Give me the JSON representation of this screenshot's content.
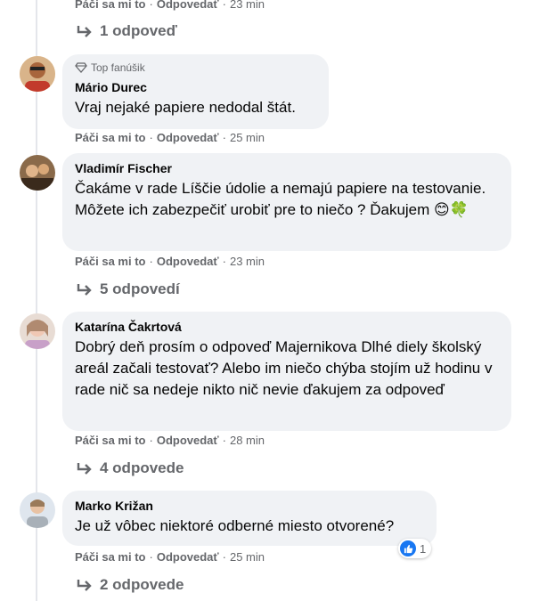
{
  "comments": [
    {
      "actions": {
        "like": "Páči sa mi to",
        "reply": "Odpovedať",
        "time": "23 min"
      },
      "replies_label": "1 odpoveď"
    },
    {
      "badge": "Top fanúšik",
      "author": "Mário Durec",
      "text": "Vraj nejaké papiere nedodal štát.",
      "actions": {
        "like": "Páči sa mi to",
        "reply": "Odpovedať",
        "time": "25 min"
      }
    },
    {
      "author": "Vladimír Fischer",
      "text": "Čakáme v rade Líščie údolie a nemajú papiere na testovanie. Môžete ich zabezpečiť urobiť pre to niečo ? Ďakujem 😊🍀",
      "actions": {
        "like": "Páči sa mi to",
        "reply": "Odpovedať",
        "time": "23 min"
      },
      "replies_label": "5 odpovedí"
    },
    {
      "author": "Katarína Čakrtová",
      "text": "Dobrý deň prosím o odpoveď Majernikova Dlhé diely školský areál začali testovať? Alebo im niečo chýba stojím už hodinu v rade nič sa nedeje nikto nič nevie ďakujem za odpoveď",
      "actions": {
        "like": "Páči sa mi to",
        "reply": "Odpovedať",
        "time": "28 min"
      },
      "replies_label": "4 odpovede"
    },
    {
      "author": "Marko Križan",
      "text": "Je už vôbec niektoré odberné miesto otvorené?",
      "actions": {
        "like": "Páči sa mi to",
        "reply": "Odpovedať",
        "time": "25 min"
      },
      "reaction": {
        "icon": "like-icon",
        "count": "1"
      },
      "replies_label": "2 odpovede"
    }
  ],
  "colors": {
    "bubble": "#f0f2f5",
    "meta": "#65676b",
    "like": "#1877f2"
  }
}
